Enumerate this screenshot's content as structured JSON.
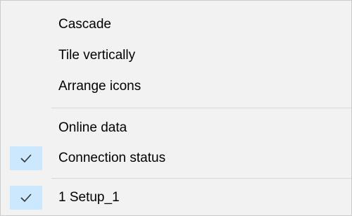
{
  "menu": {
    "items": [
      {
        "label": "Cascade",
        "checked": false
      },
      {
        "label": "Tile vertically",
        "checked": false
      },
      {
        "label": "Arrange icons",
        "checked": false
      },
      {
        "label": "Online data",
        "checked": false
      },
      {
        "label": "Connection status",
        "checked": true
      },
      {
        "label": "1 Setup_1",
        "checked": true
      }
    ]
  },
  "colors": {
    "menu_background": "#f2f2f2",
    "checkmark_highlight": "#cce8ff",
    "checkmark": "#333333",
    "separator": "#d7d7d7"
  }
}
